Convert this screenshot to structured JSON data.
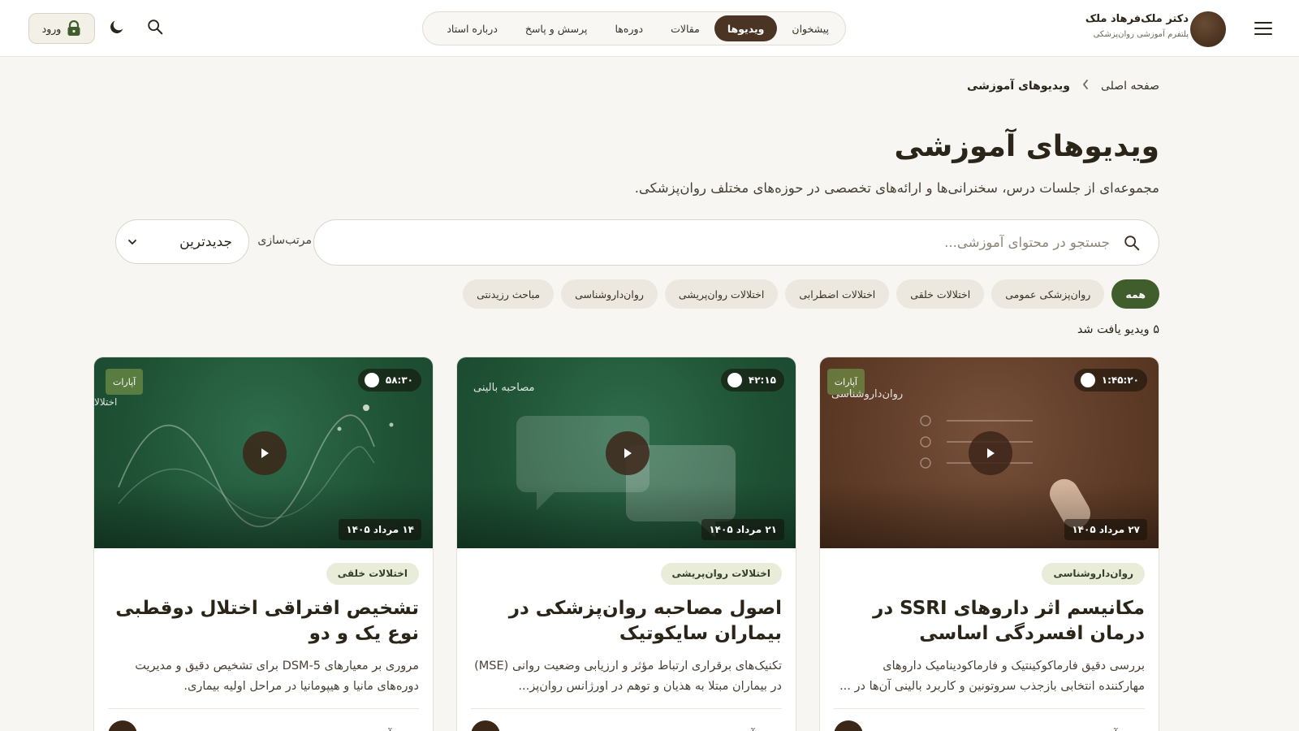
{
  "header": {
    "brand_name": "دکتر ملک‌فرهاد ملک",
    "brand_subtitle": "پلتفرم آموزشی روان‌پزشکی",
    "nav": [
      "پیشخوان",
      "ویدیوها",
      "مقالات",
      "دوره‌ها",
      "پرسش و پاسخ",
      "درباره استاد"
    ],
    "nav_active": "ویدیوها",
    "login_label": "ورود"
  },
  "breadcrumb": {
    "home": "صفحه اصلی",
    "current": "ویدیوهای آموزشی"
  },
  "page": {
    "title": "ویدیوهای آموزشی",
    "subtitle": "مجموعه‌ای از جلسات درس، سخنرانی‌ها و ارائه‌های تخصصی در حوزه‌های مختلف روان‌پزشکی."
  },
  "search": {
    "placeholder": "جستجو در محتوای آموزشی...",
    "value": ""
  },
  "sort": {
    "label": "مرتب‌سازی",
    "selected": "جدیدترین"
  },
  "filters": [
    "همه",
    "روان‌پزشکی عمومی",
    "اختلالات خلقی",
    "اختلالات اضطرابی",
    "اختلالات روان‌پریشی",
    "روان‌داروشناسی",
    "مباحث رزیدنتی"
  ],
  "filter_active": "همه",
  "result_count": "۵ ویدیو یافت شد",
  "cards": [
    {
      "duration": "۱:۴۵:۲۰",
      "source": "آپارات",
      "thumb_label": "روان‌داروشناسی",
      "date": "۲۷ مرداد ۱۴۰۵",
      "category": "روان‌داروشناسی",
      "title": "مکانیسم اثر داروهای SSRI در درمان افسردگی اساسی",
      "description": "بررسی دقیق فارماکوکینتیک و فارماکودینامیک داروهای مهارکننده انتخابی بازجذب سروتونین و کاربرد بالینی آن‌ها در ...",
      "type": "ویدیو آموزشی",
      "theme": "brown"
    },
    {
      "duration": "۴۲:۱۵",
      "source": "",
      "thumb_label": "مصاحبه بالینی",
      "date": "۲۱ مرداد ۱۴۰۵",
      "category": "اختلالات روان‌پریشی",
      "title": "اصول مصاحبه روان‌پزشکی در بیماران سایکوتیک",
      "description": "تکنیک‌های برقراری ارتباط مؤثر و ارزیابی وضعیت روانی (MSE) در بیماران مبتلا به هذیان و توهم در اورژانس روان‌پز...",
      "type": "ویدیو آموزشی",
      "theme": "green"
    },
    {
      "duration": "۵۸:۳۰",
      "source": "آپارات",
      "thumb_label": "اختلالا",
      "date": "۱۴ مرداد ۱۴۰۵",
      "category": "اختلالات خلقی",
      "title": "تشخیص افتراقی اختلال دوقطبی نوع یک و دو",
      "description": "مروری بر معیارهای DSM-5 برای تشخیص دقیق و مدیریت دوره‌های مانیا و هیپومانیا در مراحل اولیه بیماری.",
      "type": "ویدیو آموزشی",
      "theme": "green"
    }
  ],
  "colors": {
    "brand_dark": "#4a3424",
    "accent_green": "#3f5e2c",
    "background": "#f7f6f3"
  }
}
